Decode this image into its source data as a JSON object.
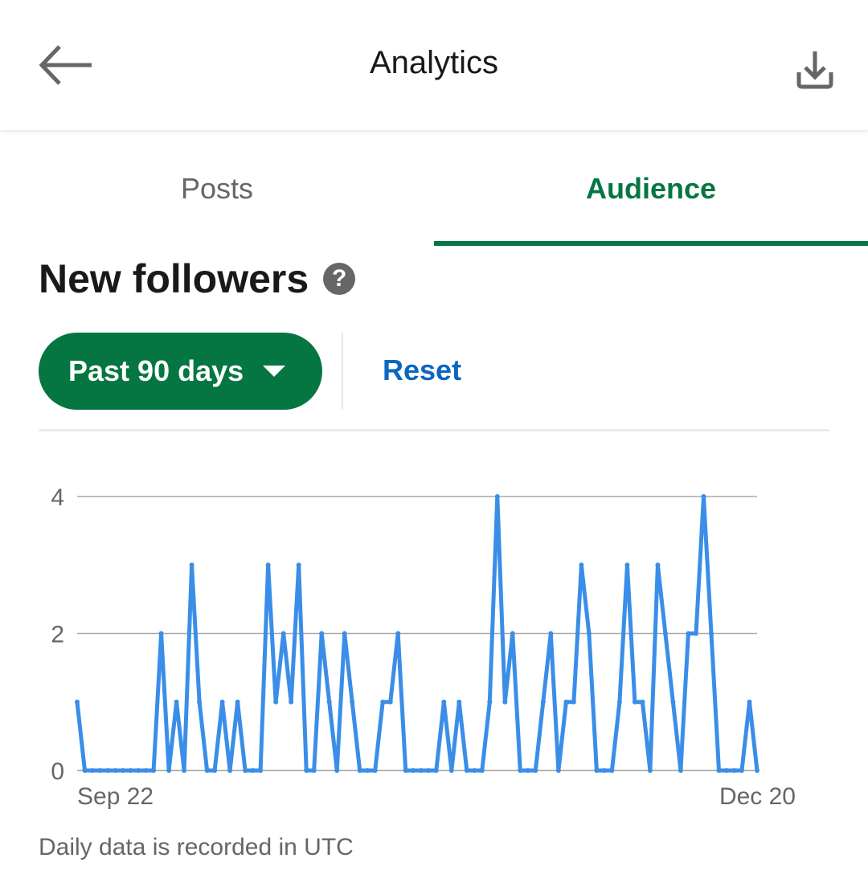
{
  "header": {
    "title": "Analytics",
    "back_icon": "arrow-left-icon",
    "download_icon": "download-icon"
  },
  "tabs": [
    {
      "label": "Posts",
      "active": false
    },
    {
      "label": "Audience",
      "active": true
    }
  ],
  "section": {
    "title": "New followers",
    "help_icon": "?"
  },
  "filters": {
    "range_label": "Past 90 days",
    "reset_label": "Reset"
  },
  "caption": "Daily data is recorded in UTC",
  "colors": {
    "accent_green": "#057642",
    "link_blue": "#0a66c2",
    "line_blue": "#3a8ee8"
  },
  "chart_data": {
    "type": "line",
    "title": "New followers",
    "xlabel": "",
    "ylabel": "",
    "x_start": "Sep 22",
    "x_end": "Dec 20",
    "x_tick_labels": [
      "Sep 22",
      "Dec 20"
    ],
    "y_ticks": [
      0,
      2,
      4
    ],
    "ylim": [
      0,
      4
    ],
    "grid": true,
    "legend": "none",
    "series": [
      {
        "name": "New followers",
        "values": [
          1,
          0,
          0,
          0,
          0,
          0,
          0,
          0,
          0,
          0,
          0,
          2,
          0,
          1,
          0,
          3,
          1,
          0,
          0,
          1,
          0,
          1,
          0,
          0,
          0,
          3,
          1,
          2,
          1,
          3,
          0,
          0,
          2,
          1,
          0,
          2,
          1,
          0,
          0,
          0,
          1,
          1,
          2,
          0,
          0,
          0,
          0,
          0,
          1,
          0,
          1,
          0,
          0,
          0,
          1,
          4,
          1,
          2,
          0,
          0,
          0,
          1,
          2,
          0,
          1,
          1,
          3,
          2,
          0,
          0,
          0,
          1,
          3,
          1,
          1,
          0,
          3,
          2,
          1,
          0,
          2,
          2,
          4,
          2,
          0,
          0,
          0,
          0,
          1,
          0
        ]
      }
    ]
  }
}
